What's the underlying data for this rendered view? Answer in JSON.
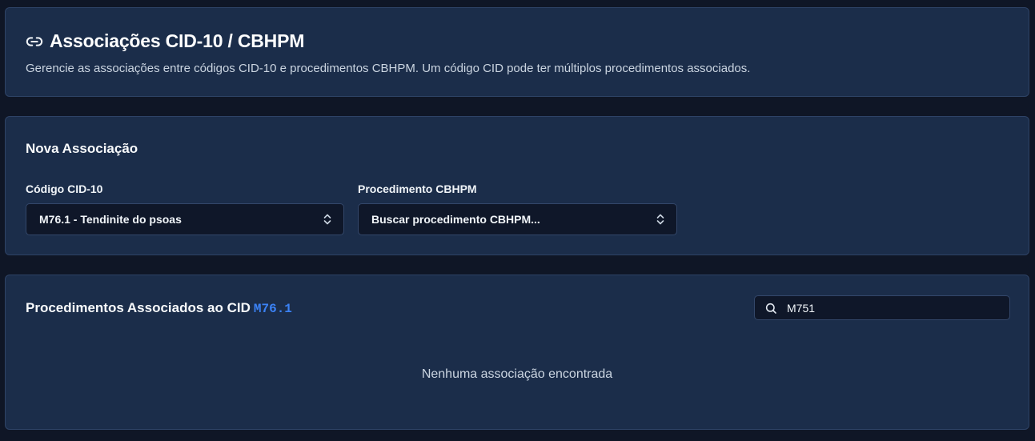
{
  "header": {
    "icon": "link-icon",
    "title": "Associações CID-10 / CBHPM",
    "description": "Gerencie as associações entre códigos CID-10 e procedimentos CBHPM. Um código CID pode ter múltiplos procedimentos associados."
  },
  "new_association": {
    "title": "Nova Associação",
    "cid_label": "Código CID-10",
    "cid_value": "M76.1 - Tendinite do psoas",
    "procedure_label": "Procedimento CBHPM",
    "procedure_placeholder": "Buscar procedimento CBHPM..."
  },
  "associated": {
    "title_prefix": "Procedimentos Associados ao CID",
    "cid_code": "M76.1",
    "search_value": "M751",
    "empty_message": "Nenhuma associação encontrada"
  },
  "colors": {
    "background": "#0f1626",
    "card": "#1b2d4a",
    "accent": "#3b82f6"
  }
}
